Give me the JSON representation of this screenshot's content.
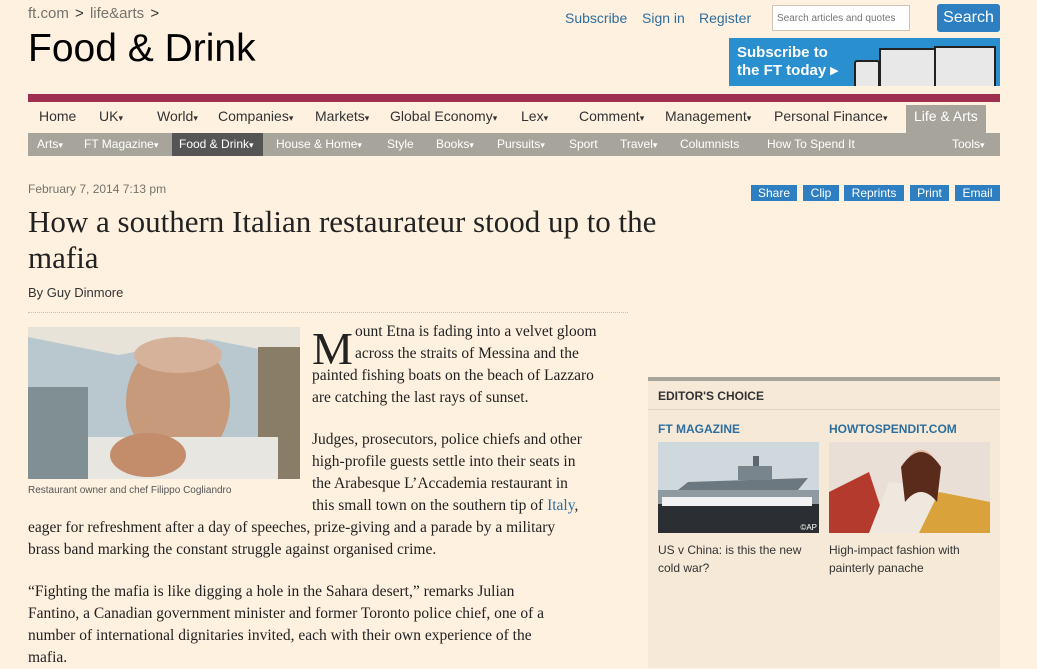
{
  "breadcrumb": {
    "site": "ft.com",
    "sep": ">",
    "section": "life&arts",
    "end": ">"
  },
  "section_title": "Food & Drink",
  "header_links": {
    "subscribe": "Subscribe",
    "signin": "Sign in",
    "register": "Register"
  },
  "search": {
    "placeholder": "Search articles and quotes",
    "button": "Search"
  },
  "promo": {
    "line1": "Subscribe to",
    "line2": "the FT today ▸"
  },
  "nav_primary": [
    "Home",
    "UK",
    "World",
    "Companies",
    "Markets",
    "Global Economy",
    "Lex",
    "Comment",
    "Management",
    "Personal Finance",
    "Life & Arts"
  ],
  "nav_secondary": [
    "Arts",
    "FT Magazine",
    "Food & Drink",
    "House & Home",
    "Style",
    "Books",
    "Pursuits",
    "Sport",
    "Travel",
    "Columnists",
    "How To Spend It",
    "Tools"
  ],
  "caret": "▾",
  "article": {
    "date": "February 7, 2014 7:13 pm",
    "tools": [
      "Share",
      "Clip",
      "Reprints",
      "Print",
      "Email"
    ],
    "headline": "How a southern Italian restaurateur stood up to the mafia",
    "byline": "By Guy Dinmore",
    "caption": "Restaurant owner and chef Filippo Cogliandro",
    "dropcap": "M",
    "p1_lines": [
      "ount Etna is fading into a velvet gloom",
      "across the straits of Messina and the",
      "painted fishing boats on the beach of Lazzaro",
      "are catching the last rays of sunset."
    ],
    "p2_lines": [
      "Judges, prosecutors, police chiefs and other",
      "high-profile guests settle into their seats in",
      "the Arabesque L’Accademia restaurant in"
    ],
    "p2_line4_pre": "this small town on the southern tip of ",
    "p2_link": "Italy",
    "p2_line4_post": ",",
    "p2_full_lines": [
      "eager for refreshment after a day of speeches, prize-giving and a parade by a military",
      "brass band marking the constant struggle against organised crime."
    ],
    "p3_lines": [
      "“Fighting the mafia is like digging a hole in the Sahara desert,” remarks Julian",
      "Fantino, a Canadian government minister and former Toronto police chief, one of a",
      "number of international dignitaries invited, each with their own experience of the",
      "mafia."
    ]
  },
  "editors_choice": {
    "heading": "EDITOR'S CHOICE",
    "items": [
      {
        "label": "FT MAGAZINE",
        "caption": "US v China: is this the new cold war?",
        "credit": "©AP"
      },
      {
        "label": "HOWTOSPENDIT.COM",
        "caption": "High-impact fashion with painterly panache"
      }
    ]
  },
  "colors": {
    "background": "#fff1e0",
    "accent": "#9e2f50",
    "link": "#2e6e9e",
    "button": "#2d7fc1",
    "nav_grey": "#a7a59b"
  }
}
